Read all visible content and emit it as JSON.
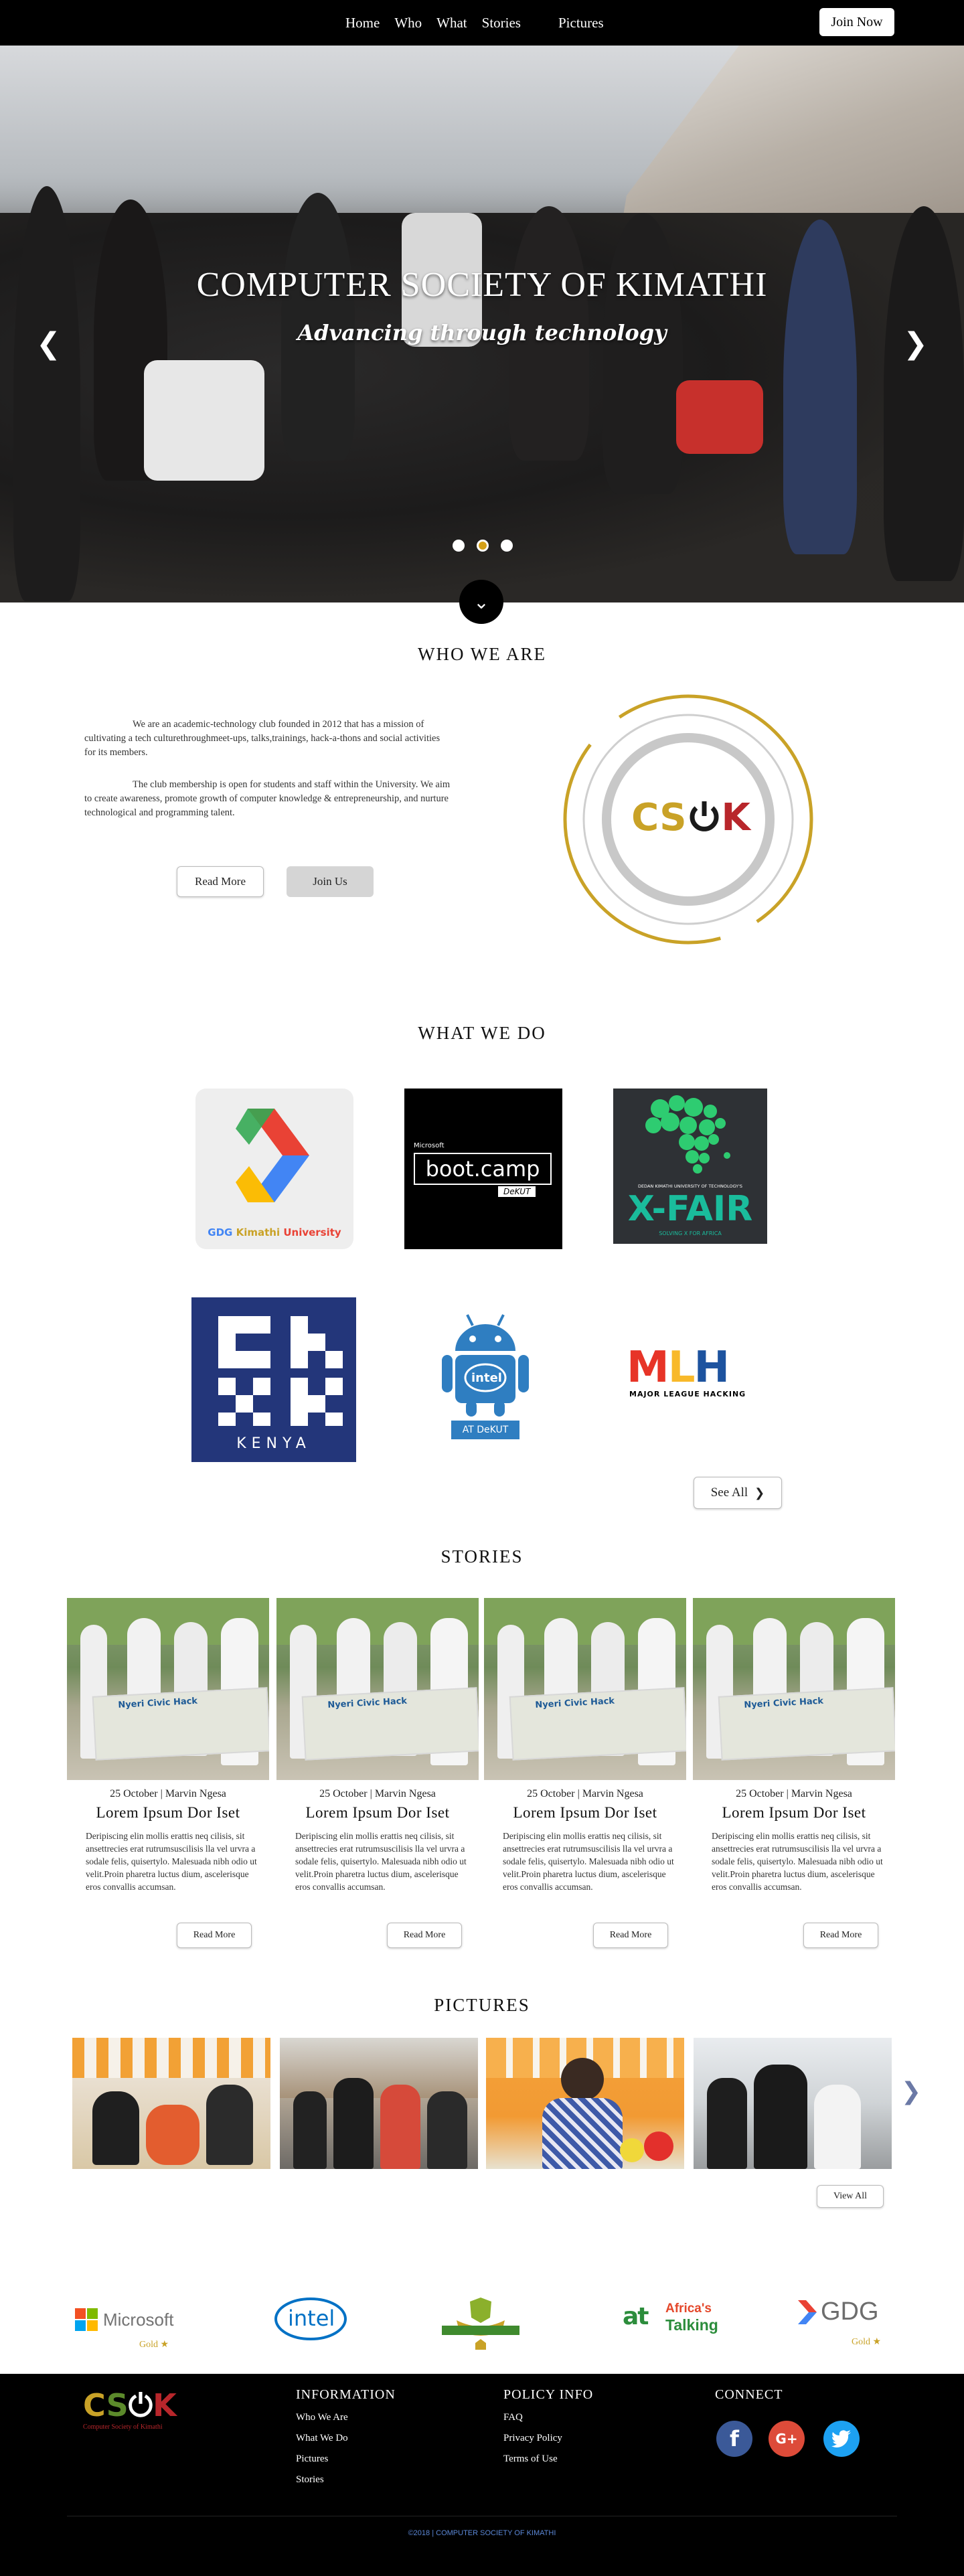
{
  "nav": {
    "items": [
      "Home",
      "Who",
      "What",
      "Stories",
      "Pictures"
    ],
    "join_label": "Join Now"
  },
  "hero": {
    "title": "COMPUTER SOCIETY OF KIMATHI",
    "subtitle": "Advancing through technology",
    "prev_icon": "chevron-left-icon",
    "next_icon": "chevron-right-icon"
  },
  "who": {
    "title": "WHO WE ARE",
    "para1": "We are an academic-technology club founded in 2012 that has a mission of cultivating a tech culturethroughmeet-ups, talks,trainings, hack-a-thons and social activities for its members.",
    "para2": "The club membership is open for students and staff within the University. We aim to create awareness, promote growth of computer knowledge & entrepreneurship, and nurture technological and programming talent.",
    "read_more": "Read More",
    "join_us": "Join Us",
    "logo_text": "CS",
    "logo_text2": "K"
  },
  "what": {
    "title": "WHAT WE DO",
    "gdg_label_a": "GDG ",
    "gdg_label_b": "Kimathi",
    "gdg_label_c": " University",
    "bootcamp_ms": "Microsoft",
    "bootcamp_label": "boot.camp",
    "bootcamp_sub": "DeKUT",
    "xfair_label": "X-FAIR",
    "xfair_sub": "SOLVING X FOR AFRICA",
    "xfair_top": "DEDAN KIMATHI UNIVERSITY OF TECHNOLOGY'S",
    "ck_label": "KENYA",
    "android_label": "AT DeKUT",
    "android_intel": "intel",
    "mlh_label": "MLH",
    "mlh_sub": "MAJOR LEAGUE HACKING",
    "see_all": "See All"
  },
  "stories": {
    "title": "STORIES",
    "items": [
      {
        "meta": "25 October | Marvin Ngesa",
        "title": "Lorem Ipsum Dor Iset",
        "body": "Deripiscing elin mollis erattis neq cilisis, sit ansettrecies erat rutrumsuscilisis lla vel urvra a sodale felis, quisertylo. Malesuada nibh odio ut velit.Proin pharetra luctus dium, ascelerisque eros convallis accumsan.",
        "button": "Read More",
        "banner": "Nyeri Civic Hack"
      },
      {
        "meta": "25 October | Marvin Ngesa",
        "title": "Lorem Ipsum Dor Iset",
        "body": "Deripiscing elin mollis erattis neq cilisis, sit ansettrecies erat rutrumsuscilisis lla vel urvra a sodale felis, quisertylo. Malesuada nibh odio ut velit.Proin pharetra luctus dium, ascelerisque eros convallis accumsan.",
        "button": "Read More",
        "banner": "Nyeri Civic Hack"
      },
      {
        "meta": "25 October | Marvin Ngesa",
        "title": "Lorem Ipsum Dor Iset",
        "body": "Deripiscing elin mollis erattis neq cilisis, sit ansettrecies erat rutrumsuscilisis lla vel urvra a sodale felis, quisertylo. Malesuada nibh odio ut velit.Proin pharetra luctus dium, ascelerisque eros convallis accumsan.",
        "button": "Read More",
        "banner": "Nyeri Civic Hack"
      },
      {
        "meta": "25 October | Marvin Ngesa",
        "title": "Lorem Ipsum Dor Iset",
        "body": "Deripiscing elin mollis erattis neq cilisis, sit ansettrecies erat rutrumsuscilisis lla vel urvra a sodale felis, quisertylo. Malesuada nibh odio ut velit.Proin pharetra luctus dium, ascelerisque eros convallis accumsan.",
        "button": "Read More",
        "banner": "Nyeri Civic Hack"
      }
    ]
  },
  "pictures": {
    "title": "PICTURES",
    "view_all": "View All",
    "next_icon": "chevron-right-icon"
  },
  "partners": {
    "microsoft": "Microsoft",
    "microsoft_tier": "Gold",
    "intel": "intel",
    "africas_talking_a": "Africa's",
    "africas_talking_b": "Talking",
    "gdg": "GDG",
    "gdg_tier": "Gold"
  },
  "footer": {
    "logo_sub": "Computer Society of Kimathi",
    "information": {
      "title": "INFORMATION",
      "links": [
        "Who We Are",
        "What We Do",
        "Pictures",
        "Stories"
      ]
    },
    "policy": {
      "title": "POLICY INFO",
      "links": [
        "FAQ",
        "Privacy Policy",
        "Terms of Use"
      ]
    },
    "connect": {
      "title": "CONNECT"
    },
    "copyright": "©2018 | COMPUTER SOCIETY OF KIMATHI"
  },
  "colors": {
    "gold": "#c9a227",
    "brand_red": "#b8262b",
    "brand_green": "#5c8a2b",
    "facebook": "#3b5998",
    "google_plus": "#dd4b39",
    "twitter": "#1da1f2"
  }
}
